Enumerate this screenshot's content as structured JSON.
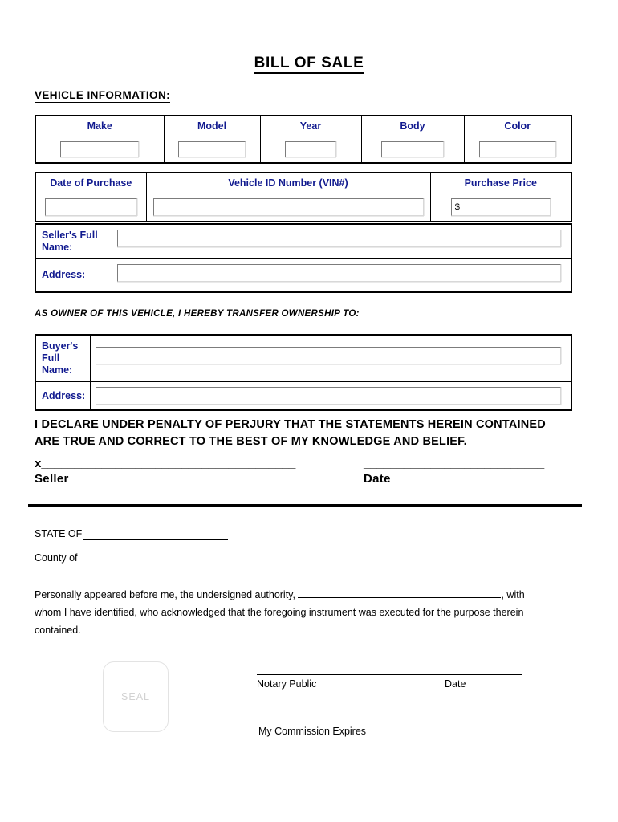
{
  "document": {
    "title": "BILL OF SALE"
  },
  "vehicle_section": {
    "heading": "VEHICLE INFORMATION:",
    "specs_headers": [
      "Make",
      "Model",
      "Year",
      "Body",
      "Color"
    ],
    "specs_values": [
      "",
      "",
      "",
      "",
      ""
    ],
    "purchase_headers": [
      "Date of Purchase",
      "Vehicle ID Number (VIN#)",
      "Purchase Price"
    ],
    "purchase_values": [
      "",
      "",
      "$"
    ]
  },
  "seller": {
    "name_label": "Seller's Full Name:",
    "name_value": "",
    "address_label": "Address:",
    "address_value": ""
  },
  "transfer": {
    "statement": "AS OWNER OF THIS VEHICLE, I HEREBY TRANSFER OWNERSHIP TO:"
  },
  "buyer": {
    "name_label": "Buyer's Full Name:",
    "name_value": "",
    "address_label": "Address:",
    "address_value": ""
  },
  "declaration": {
    "line1": "I DECLARE UNDER PENALTY OF PERJURY THAT THE STATEMENTS HEREIN CONTAINED",
    "line2": "ARE TRUE AND CORRECT TO THE BEST OF MY KNOWLEDGE AND BELIEF."
  },
  "signature": {
    "x_mark": "x",
    "seller_rule": "______________________________________",
    "seller_caption": "Seller",
    "date_rule": "___________________________",
    "date_caption": "Date"
  },
  "notary": {
    "state_label": "STATE OF",
    "state_value": "",
    "county_label": "County of",
    "county_value": "",
    "paragraph_part1": "Personally appeared before me, the undersigned authority,",
    "paragraph_name_value": "",
    "paragraph_part2": ", with",
    "paragraph_line2": "whom I have identified, who acknowledged that the foregoing instrument was executed for the purpose therein",
    "paragraph_line3": "contained.",
    "seal_text": "SEAL",
    "notary_public_label": "Notary Public",
    "notary_date_label": "Date",
    "commission_label": "My Commission Expires",
    "notary_public_value": "",
    "notary_date_value": "",
    "commission_value": ""
  },
  "colors": {
    "header_blue": "#111a8f",
    "text_black": "#000000",
    "seal_gray": "#d2d2d2"
  }
}
